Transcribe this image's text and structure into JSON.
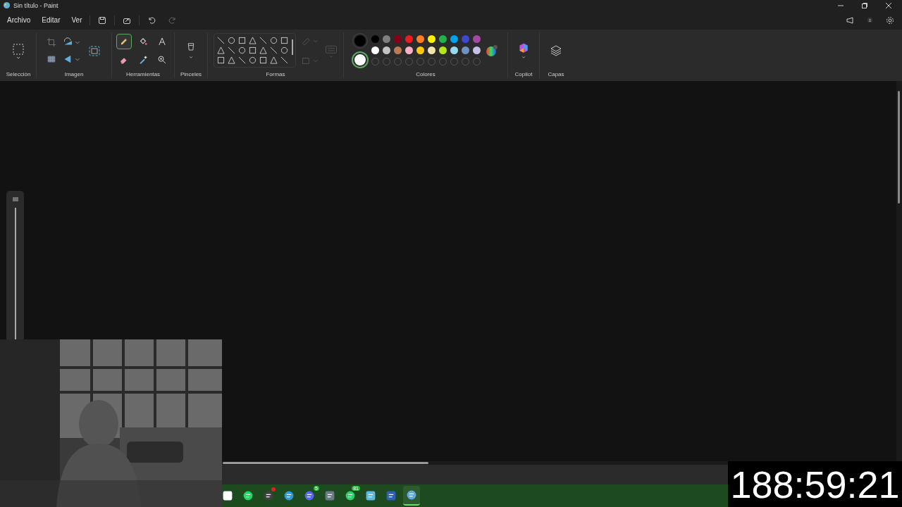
{
  "window": {
    "title": "Sin título - Paint"
  },
  "menu": [
    "Archivo",
    "Editar",
    "Ver"
  ],
  "ribbon": {
    "groups": [
      "Selección",
      "Imagen",
      "Herramientas",
      "Pinceles",
      "Formas",
      "Colores",
      "Copilot",
      "Capas"
    ],
    "tools": [
      {
        "selected": true
      },
      {
        "selected": false
      },
      {
        "selected": false
      },
      {
        "selected": false
      },
      {
        "selected": false
      },
      {
        "selected": false
      }
    ],
    "primary_color": {
      "color": "#000000",
      "selected": false
    },
    "secondary_color": {
      "color": "#ffffff",
      "selected": true
    },
    "palette": [
      {
        "color": "#000000"
      },
      {
        "color": "#7f7f7f"
      },
      {
        "color": "#880015"
      },
      {
        "color": "#ed1c24"
      },
      {
        "color": "#ff7f27"
      },
      {
        "color": "#fff200"
      },
      {
        "color": "#22b14c"
      },
      {
        "color": "#00a2e8"
      },
      {
        "color": "#3f48cc"
      },
      {
        "color": "#a349a4"
      },
      {
        "color": "#ffffff"
      },
      {
        "color": "#c3c3c3"
      },
      {
        "color": "#b97a57"
      },
      {
        "color": "#ffaec9"
      },
      {
        "color": "#ffc90e"
      },
      {
        "color": "#efe4b0"
      },
      {
        "color": "#b5e61d"
      },
      {
        "color": "#99d9ea"
      },
      {
        "color": "#7092be"
      },
      {
        "color": "#c8bfe7"
      }
    ]
  },
  "taskbar": {
    "apps": [
      {
        "kind": "capcut",
        "selected": false
      },
      {
        "kind": "spotify",
        "selected": false
      },
      {
        "kind": "obs",
        "selected": false,
        "notify": true
      },
      {
        "kind": "edge",
        "selected": false
      },
      {
        "kind": "discord",
        "selected": false,
        "badge": "5"
      },
      {
        "kind": "calculator",
        "selected": false
      },
      {
        "kind": "whatsapp",
        "selected": false,
        "badge": "81"
      },
      {
        "kind": "notepad",
        "selected": false
      },
      {
        "kind": "word",
        "selected": false
      },
      {
        "kind": "paint",
        "selected": true
      }
    ]
  },
  "zoom_slider": {
    "level": 1
  },
  "timer": "188:59:21"
}
